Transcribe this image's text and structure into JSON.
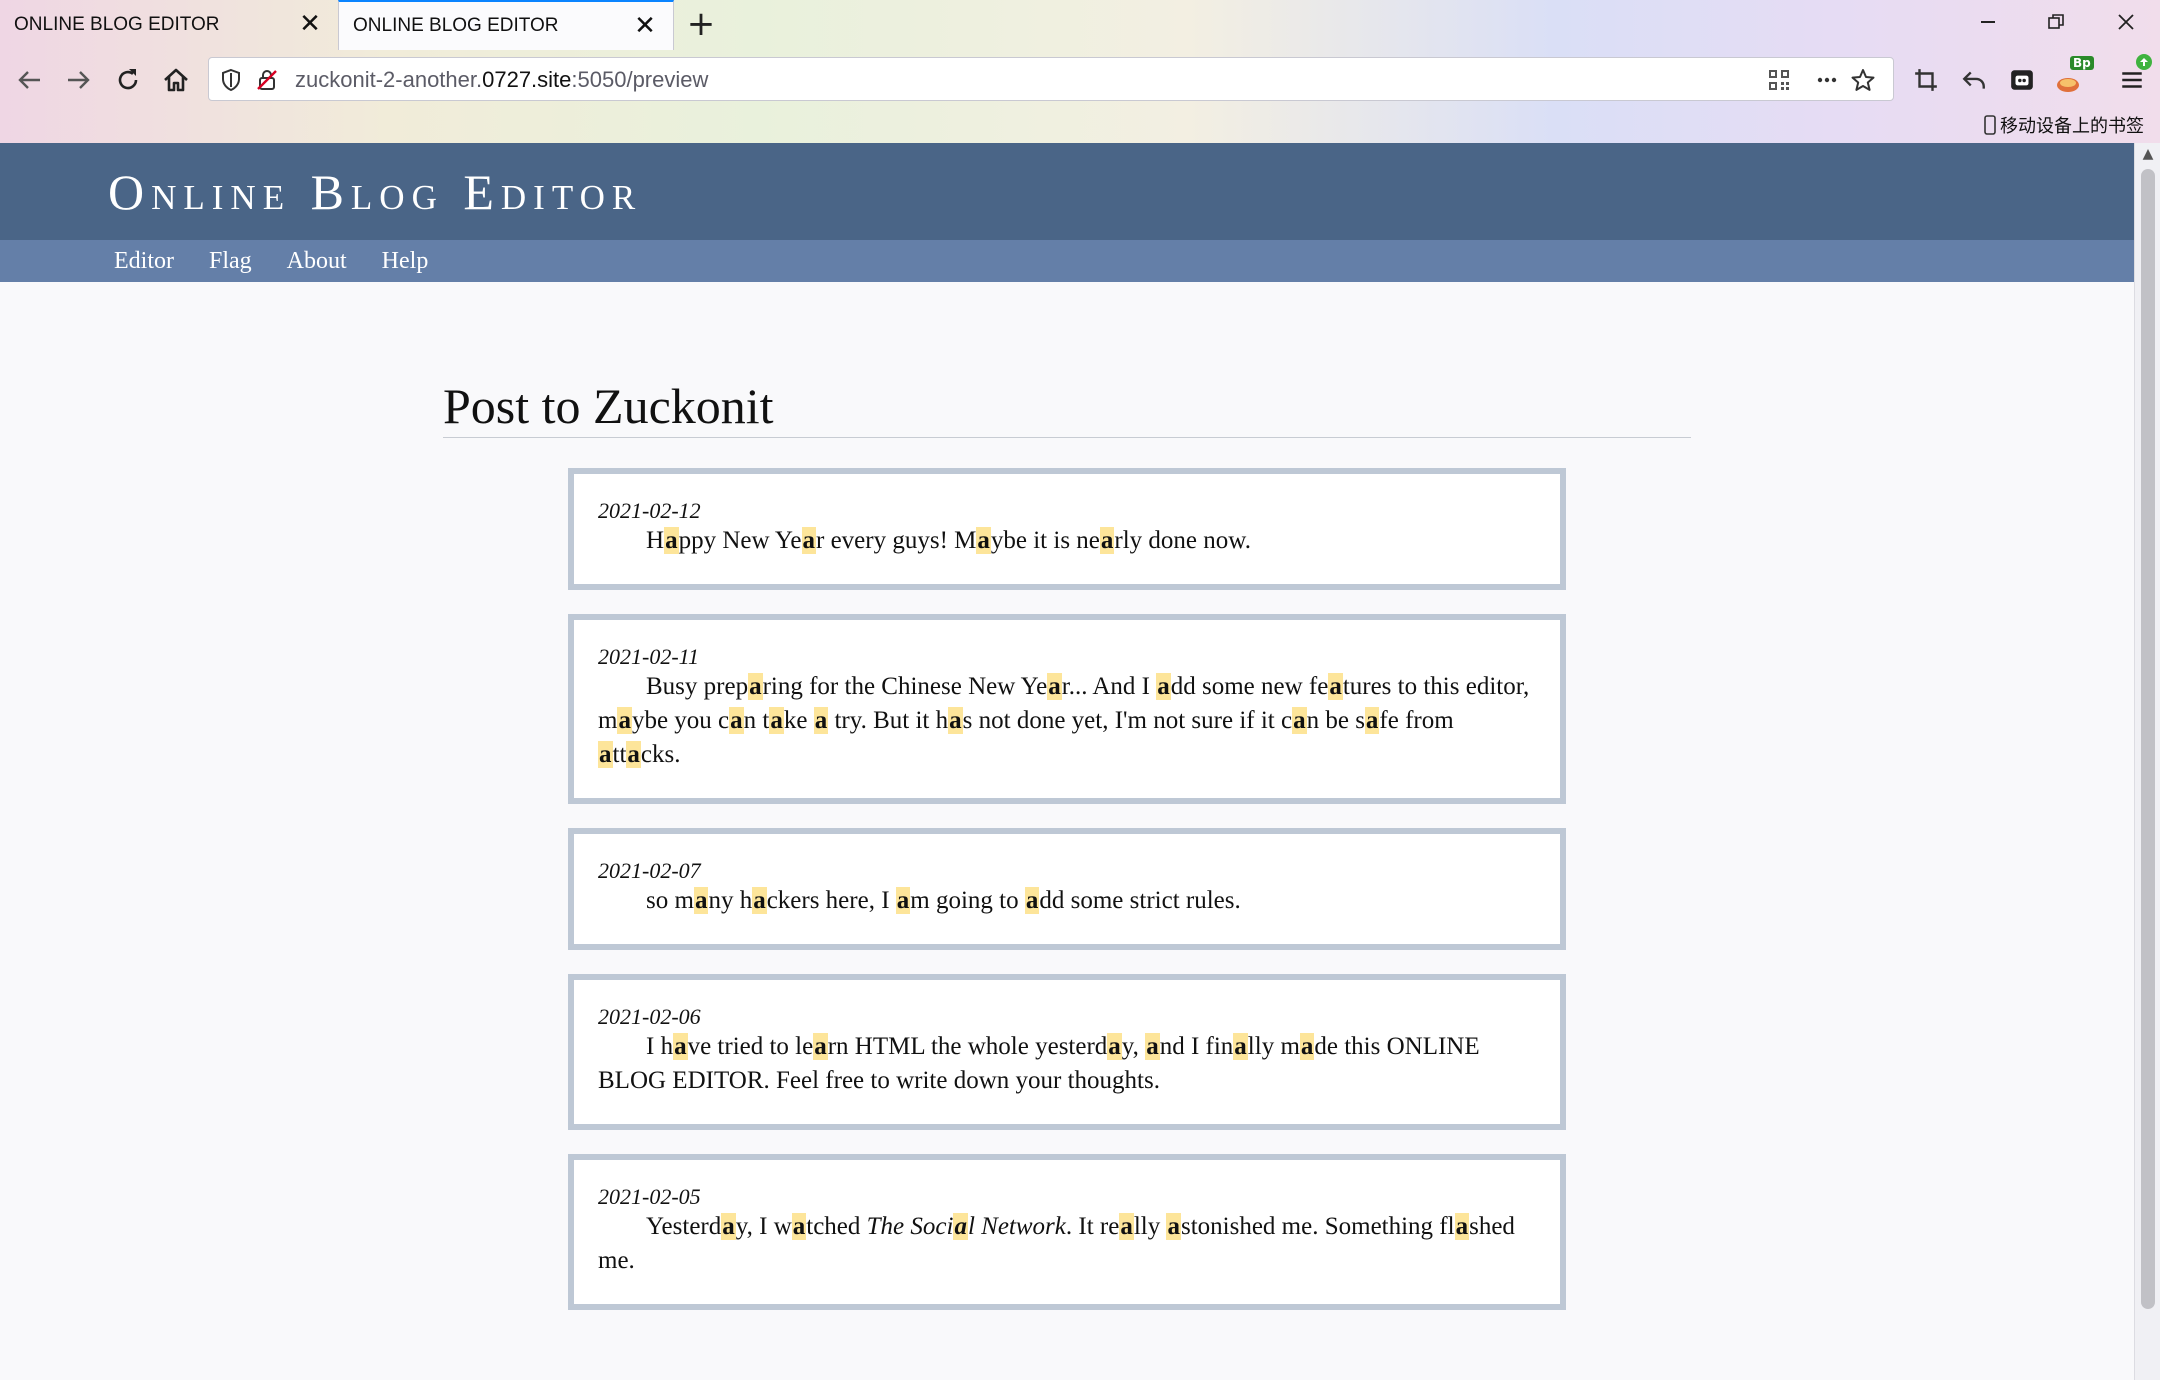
{
  "browser": {
    "tabs": [
      {
        "title": "ONLINE BLOG EDITOR",
        "close": "✕"
      },
      {
        "title": "ONLINE BLOG EDITOR",
        "close": "✕"
      }
    ],
    "new_tab": "+",
    "url": {
      "prefix": "zuckonit-2-another.",
      "host": "0727.site",
      "suffix": ":5050/preview"
    },
    "bookmarks_label": "移动设备上的书签",
    "extension_badge": "Bp",
    "window_controls": {
      "minimize": "—",
      "restore": "❐",
      "close": "✕"
    },
    "icons": [
      "back-arrow-icon",
      "forward-arrow-icon",
      "reload-icon",
      "home-icon",
      "shield-icon",
      "insecure-lock-icon",
      "qr-code-icon",
      "more-dots-icon",
      "star-icon",
      "crop-icon",
      "undo-icon",
      "container-icon",
      "extension-icon",
      "menu-icon"
    ]
  },
  "site": {
    "title": "Online Blog Editor",
    "nav": [
      "Editor",
      "Flag",
      "About",
      "Help"
    ],
    "heading": "Post to Zuckonit"
  },
  "highlight_color": "#fde59a",
  "posts": [
    {
      "date": "2021-02-12",
      "segments": [
        {
          "t": "H"
        },
        {
          "t": "a",
          "h": true
        },
        {
          "t": "ppy New Ye"
        },
        {
          "t": "a",
          "h": true
        },
        {
          "t": "r every guys! M"
        },
        {
          "t": "a",
          "h": true
        },
        {
          "t": "ybe it is ne"
        },
        {
          "t": "a",
          "h": true
        },
        {
          "t": "rly done now."
        }
      ]
    },
    {
      "date": "2021-02-11",
      "segments": [
        {
          "t": "Busy prep"
        },
        {
          "t": "a",
          "h": true
        },
        {
          "t": "ring for the Chinese New Ye"
        },
        {
          "t": "a",
          "h": true
        },
        {
          "t": "r... And I "
        },
        {
          "t": "a",
          "h": true
        },
        {
          "t": "dd some new fe"
        },
        {
          "t": "a",
          "h": true
        },
        {
          "t": "tures to this editor, m"
        },
        {
          "t": "a",
          "h": true
        },
        {
          "t": "ybe you c"
        },
        {
          "t": "a",
          "h": true
        },
        {
          "t": "n t"
        },
        {
          "t": "a",
          "h": true
        },
        {
          "t": "ke "
        },
        {
          "t": "a",
          "h": true
        },
        {
          "t": " try. But it h"
        },
        {
          "t": "a",
          "h": true
        },
        {
          "t": "s not done yet, I'm not sure if it c"
        },
        {
          "t": "a",
          "h": true
        },
        {
          "t": "n be s"
        },
        {
          "t": "a",
          "h": true
        },
        {
          "t": "fe from "
        },
        {
          "t": "a",
          "h": true
        },
        {
          "t": "tt"
        },
        {
          "t": "a",
          "h": true
        },
        {
          "t": "cks."
        }
      ]
    },
    {
      "date": "2021-02-07",
      "segments": [
        {
          "t": "so m"
        },
        {
          "t": "a",
          "h": true
        },
        {
          "t": "ny h"
        },
        {
          "t": "a",
          "h": true
        },
        {
          "t": "ckers here, I "
        },
        {
          "t": "a",
          "h": true
        },
        {
          "t": "m going to "
        },
        {
          "t": "a",
          "h": true
        },
        {
          "t": "dd some strict rules."
        }
      ]
    },
    {
      "date": "2021-02-06",
      "segments": [
        {
          "t": "I h"
        },
        {
          "t": "a",
          "h": true
        },
        {
          "t": "ve tried to le"
        },
        {
          "t": "a",
          "h": true
        },
        {
          "t": "rn HTML the whole yesterd"
        },
        {
          "t": "a",
          "h": true
        },
        {
          "t": "y, "
        },
        {
          "t": "a",
          "h": true
        },
        {
          "t": "nd I fin"
        },
        {
          "t": "a",
          "h": true
        },
        {
          "t": "lly m"
        },
        {
          "t": "a",
          "h": true
        },
        {
          "t": "de this ONLINE BLOG EDITOR. Feel free to write down your thoughts."
        }
      ]
    },
    {
      "date": "2021-02-05",
      "segments": [
        {
          "t": "Yesterd"
        },
        {
          "t": "a",
          "h": true
        },
        {
          "t": "y, I w"
        },
        {
          "t": "a",
          "h": true
        },
        {
          "t": "tched "
        },
        {
          "t": "The Soci",
          "i": true
        },
        {
          "t": "a",
          "h": true,
          "i": true
        },
        {
          "t": "l Network",
          "i": true
        },
        {
          "t": ". It re"
        },
        {
          "t": "a",
          "h": true
        },
        {
          "t": "lly "
        },
        {
          "t": "a",
          "h": true
        },
        {
          "t": "stonished me. Something fl"
        },
        {
          "t": "a",
          "h": true
        },
        {
          "t": "shed me."
        }
      ]
    }
  ]
}
